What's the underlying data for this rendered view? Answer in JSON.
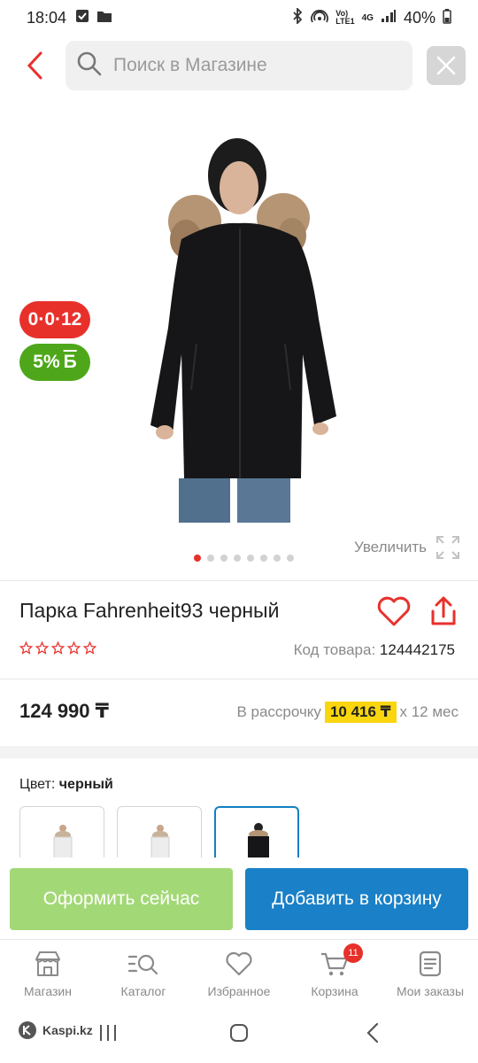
{
  "status_bar": {
    "time": "18:04",
    "battery": "40%",
    "network": "4G"
  },
  "search": {
    "placeholder": "Поиск в Магазине"
  },
  "gallery": {
    "badge_installment": "0·0·12",
    "badge_bonus": "5%",
    "badge_bonus_suffix": "Б",
    "zoom_label": "Увеличить",
    "dots_count": 8,
    "active_dot": 1
  },
  "product": {
    "title": "Парка Fahrenheit93 черный",
    "rating": 0,
    "code_label": "Код товара:",
    "code_value": "124442175",
    "price": "124 990 ₸",
    "installment_prefix": "В рассрочку",
    "installment_amount": "10 416 ₸",
    "installment_suffix": "х 12 мес",
    "color_label": "Цвет:",
    "color_value": "черный"
  },
  "actions": {
    "buy_now": "Оформить сейчас",
    "add_to_cart": "Добавить в корзину"
  },
  "bottom_nav": {
    "items": [
      {
        "label": "Магазин",
        "icon": "shop-icon"
      },
      {
        "label": "Каталог",
        "icon": "catalog-icon"
      },
      {
        "label": "Избранное",
        "icon": "heart-icon"
      },
      {
        "label": "Корзина",
        "icon": "cart-icon"
      },
      {
        "label": "Мои заказы",
        "icon": "orders-icon"
      }
    ],
    "cart_count": "11"
  },
  "system": {
    "brand": "Kaspi.kz"
  },
  "colors": {
    "accent_red": "#e8302b",
    "bonus_green": "#4ea71a",
    "buy_green": "#a3d876",
    "cart_blue": "#1a80c7",
    "installment_yellow": "#f9d60e"
  }
}
